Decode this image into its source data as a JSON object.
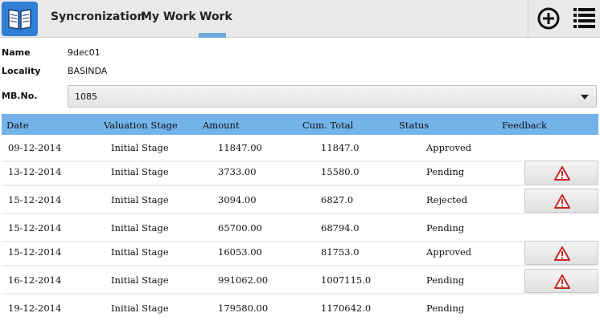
{
  "actionbar": {
    "app_icon": "book-icon",
    "tabs": [
      {
        "label": "Syncronization"
      },
      {
        "label": "My Work"
      },
      {
        "label": "Work"
      }
    ],
    "selected_tab": "Work",
    "add_icon": "add-circle-icon",
    "menu_icon": "list-menu-icon"
  },
  "info": {
    "name_label": "Name",
    "name_value": "9dec01",
    "locality_label": "Locality",
    "locality_value": "BASINDA",
    "mbno_label": "MB.No.",
    "mbno_value": "1085"
  },
  "table": {
    "headers": {
      "date": "Date",
      "stage": "Valuation Stage",
      "amount": "Amount",
      "cum_total": "Cum. Total",
      "status": "Status",
      "feedback": "Feedback"
    },
    "rows": [
      {
        "date": "09-12-2014",
        "stage": "Initial Stage",
        "amount": "11847.00",
        "cum_total": "11847.0",
        "status": "Approved",
        "feedback": false
      },
      {
        "date": "13-12-2014",
        "stage": "Initial Stage",
        "amount": "3733.00",
        "cum_total": "15580.0",
        "status": "Pending",
        "feedback": true
      },
      {
        "date": "15-12-2014",
        "stage": "Initial Stage",
        "amount": "3094.00",
        "cum_total": "6827.0",
        "status": "Rejected",
        "feedback": true
      },
      {
        "date": "15-12-2014",
        "stage": "Initial Stage",
        "amount": "65700.00",
        "cum_total": "68794.0",
        "status": "Pending",
        "feedback": false
      },
      {
        "date": "15-12-2014",
        "stage": "Initial Stage",
        "amount": "16053.00",
        "cum_total": "81753.0",
        "status": "Approved",
        "feedback": true
      },
      {
        "date": "16-12-2014",
        "stage": "Initial Stage",
        "amount": "991062.00",
        "cum_total": "1007115.0",
        "status": "Pending",
        "feedback": true
      },
      {
        "date": "19-12-2014",
        "stage": "Initial Stage",
        "amount": "179580.00",
        "cum_total": "1170642.0",
        "status": "Pending",
        "feedback": false
      }
    ],
    "feedback_icon": "warning-icon"
  },
  "colors": {
    "actionbar_bg": "#e9e9e9",
    "app_icon_bg": "#2f7fd6",
    "tab_indicator": "#6fa8dc",
    "table_header_bg": "#74b3ea",
    "warning_red": "#c62828"
  }
}
